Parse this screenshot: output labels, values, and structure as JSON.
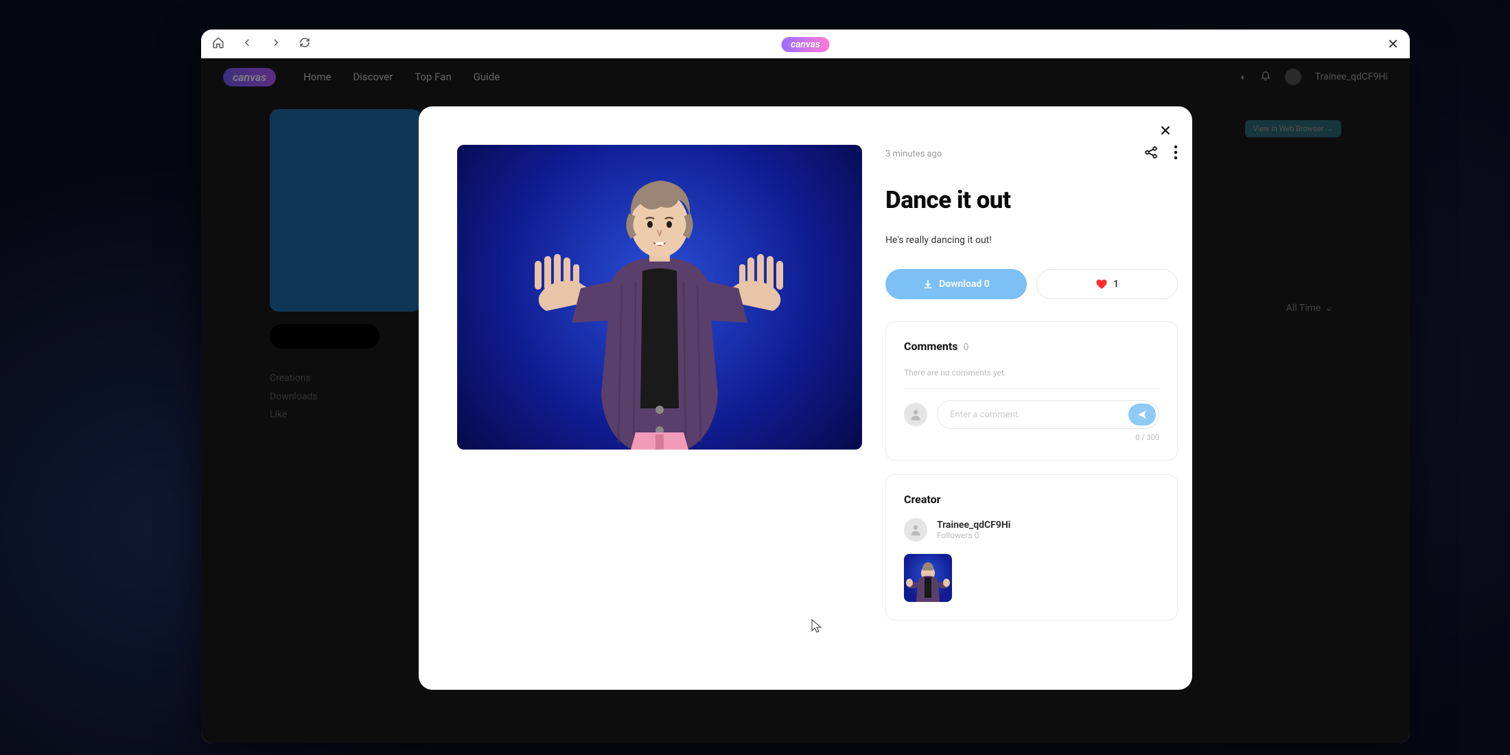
{
  "browser": {
    "title": "canvas"
  },
  "app": {
    "logo": "canvas",
    "nav": [
      "Home",
      "Discover",
      "Top Fan",
      "Guide"
    ],
    "user": "Trainee_qdCF9Hi",
    "view_browser": "View in Web Browser  →",
    "body_meta": {
      "creations": "Creations",
      "downloads": "Downloads",
      "like": "Like"
    },
    "filter": "All Time"
  },
  "modal": {
    "timestamp": "3 minutes ago",
    "title": "Dance it out",
    "description": "He's really dancing it out!",
    "download_label": "Download 0",
    "like_count": "1",
    "comments": {
      "title": "Comments",
      "count": "0",
      "empty": "There are no comments yet.",
      "placeholder": "Enter a comment.",
      "counter": "0 / 300"
    },
    "creator": {
      "title": "Creator",
      "name": "Trainee_qdCF9Hi",
      "followers_label": "Followers 0"
    }
  }
}
